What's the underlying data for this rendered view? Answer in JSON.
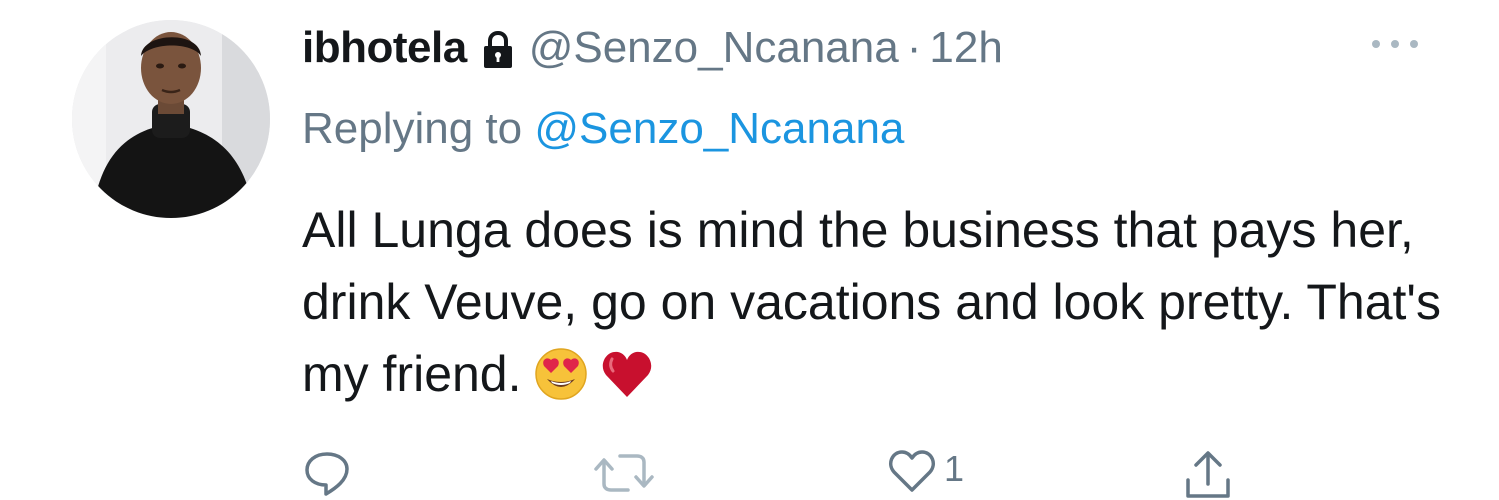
{
  "tweet": {
    "display_name": "ibhotela",
    "handle": "@Senzo_Ncanana",
    "separator": "·",
    "time": "12h",
    "replying_prefix": "Replying to",
    "replying_to": "@Senzo_Ncanana",
    "text": "All Lunga does is mind the business that pays her, drink Veuve, go on vacations and look pretty. That's my friend.",
    "emojis": [
      "heart-eyes-emoji",
      "red-heart-emoji"
    ]
  },
  "actions": {
    "reply_icon": "reply-icon",
    "retweet_icon": "retweet-icon",
    "like_icon": "heart-icon",
    "like_count": "1",
    "share_icon": "share-icon"
  },
  "icons": {
    "account_lock": "lock-icon",
    "more": "more-icon"
  },
  "colors": {
    "name": "#14171a",
    "secondary": "#657786",
    "mention": "#1b95e0",
    "action_icons": "#657786"
  }
}
